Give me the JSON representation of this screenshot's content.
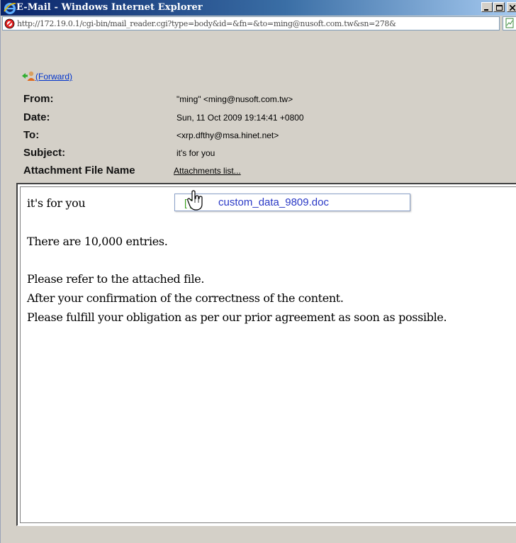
{
  "window": {
    "title": "E-Mail - Windows Internet Explorer",
    "address": "http://172.19.0.1/cgi-bin/mail_reader.cgi?type=body&id=&fn=&to=ming@nusoft.com.tw&sn=278&"
  },
  "toolbar": {
    "forward_label": "(Forward)"
  },
  "headers": {
    "from_label": "From:",
    "from_value": "\"ming\" <ming@nusoft.com.tw>",
    "date_label": "Date:",
    "date_value": "Sun, 11 Oct 2009 19:14:41 +0800",
    "to_label": "To:",
    "to_value": "<xrp.dfthy@msa.hinet.net>",
    "subject_label": "Subject:",
    "subject_value": "it's for you",
    "attachment_label": "Attachment File Name",
    "attachment_link": "Attachments list..."
  },
  "attachments": {
    "items": [
      {
        "bracket": "[ ]",
        "name": "custom_data_9809.doc"
      }
    ]
  },
  "message": {
    "lines": [
      "it's for you",
      "There are 10,000 entries.",
      "Please refer to the attached file.",
      "After your confirmation of the correctness of the content.",
      "Please fulfill your obligation as per our prior agreement as soon as possible."
    ]
  },
  "colors": {
    "titlebar_start": "#0a246a",
    "link": "#0033cc",
    "attachment_link": "#2a39c6",
    "chrome": "#d4d0c8"
  }
}
